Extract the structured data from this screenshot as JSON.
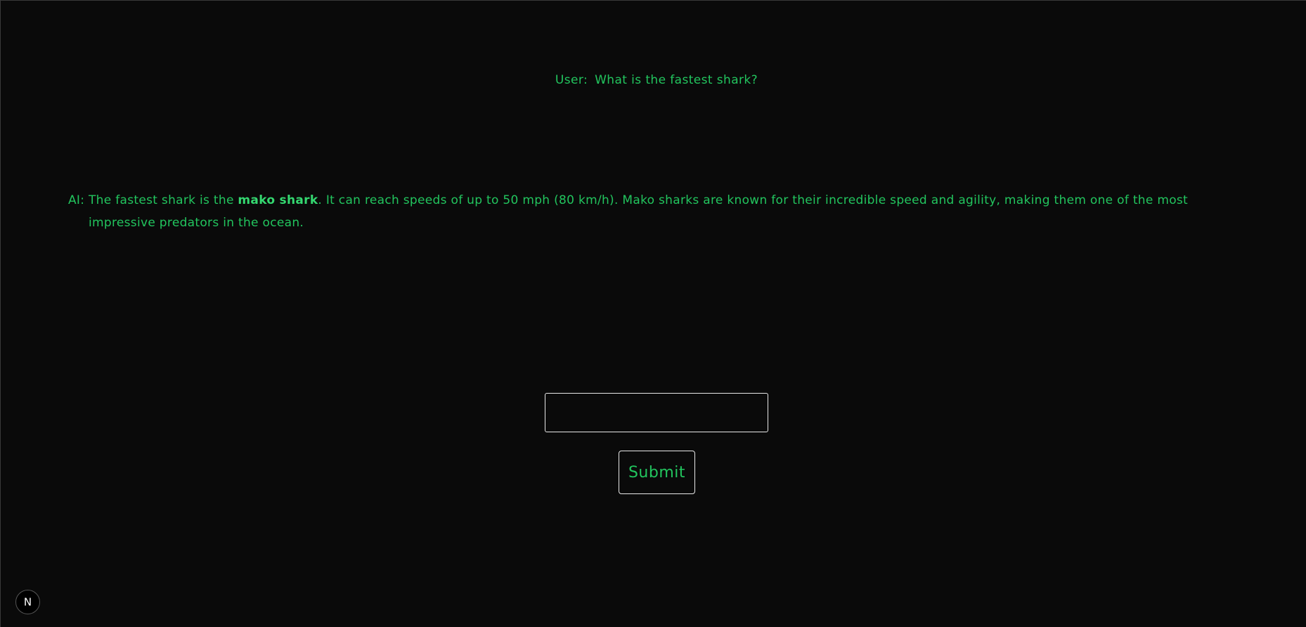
{
  "chat": {
    "user_message": {
      "prefix": "User:",
      "text": "What is the fastest shark?"
    },
    "ai_message": {
      "prefix": "AI:",
      "text_before": "The fastest shark is the ",
      "bold": "mako shark",
      "text_after": ". It can reach speeds of up to 50 mph (80 km/h). Mako sharks are known for their incredible speed and agility, making them one of the most impressive predators in the ocean."
    }
  },
  "form": {
    "input_value": "",
    "submit_label": "Submit"
  },
  "dev_badge": {
    "icon": "nextjs-logo-icon",
    "letter": "N"
  },
  "colors": {
    "background": "#0a0a0a",
    "text": "#22c55e",
    "border": "#e8e8e8"
  }
}
